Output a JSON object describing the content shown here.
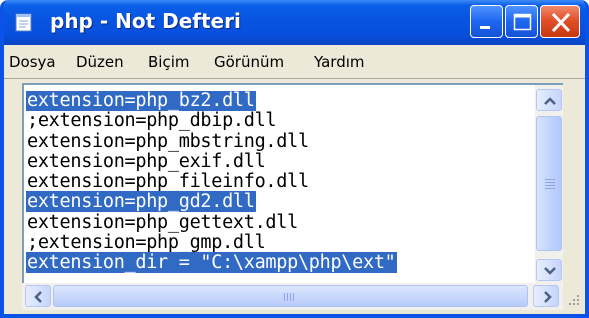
{
  "window": {
    "title": "php - Not Defteri",
    "icon": "notepad-icon"
  },
  "title_buttons": [
    {
      "name": "minimize-button",
      "icon": "minimize-icon"
    },
    {
      "name": "maximize-button",
      "icon": "maximize-icon"
    },
    {
      "name": "close-button",
      "icon": "close-icon"
    }
  ],
  "menu": {
    "items": [
      {
        "label": "Dosya"
      },
      {
        "label": "Düzen"
      },
      {
        "label": "Biçim"
      },
      {
        "label": "Görünüm"
      },
      {
        "label": "Yardım"
      }
    ]
  },
  "editor": {
    "lines": [
      {
        "text": "extension=php_bz2.dll",
        "selected": true
      },
      {
        "text": ";extension=php_dbip.dll",
        "selected": false
      },
      {
        "text": "extension=php_mbstring.dll",
        "selected": false
      },
      {
        "text": "extension=php_exif.dll",
        "selected": false
      },
      {
        "text": "extension=php_fileinfo.dll",
        "selected": false
      },
      {
        "text": "extension=php_gd2.dll",
        "selected": true
      },
      {
        "text": "extension=php_gettext.dll",
        "selected": false
      },
      {
        "text": ";extension=php_gmp.dll",
        "selected": false
      },
      {
        "text": "extension_dir = \"C:\\xampp\\php\\ext\"",
        "selected": true
      }
    ]
  },
  "colors": {
    "titlebar": "#0a5fe8",
    "selection": "#316ac5",
    "close_button": "#e0512a"
  }
}
